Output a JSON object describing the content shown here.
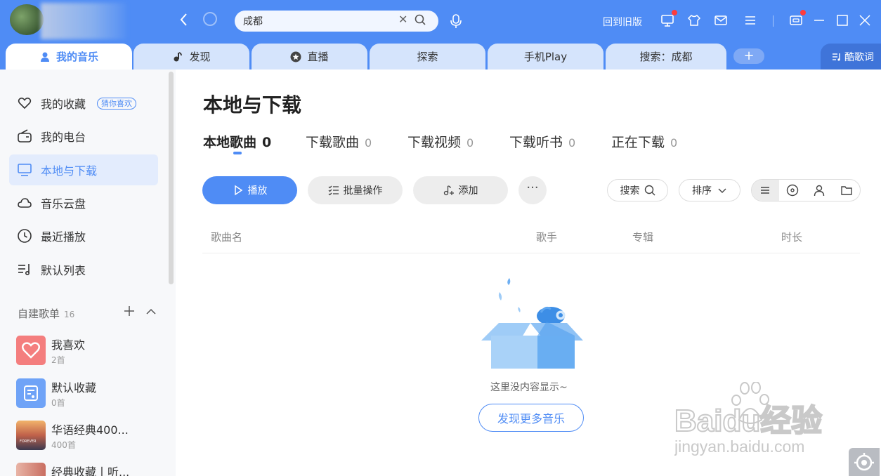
{
  "topbar": {
    "search_value": "成都",
    "old_version_label": "回到旧版",
    "accent_color": "#4f8cf5"
  },
  "tabs": [
    {
      "label": "我的音乐",
      "icon": "user-icon",
      "active": true
    },
    {
      "label": "发现",
      "icon": "music-note-icon"
    },
    {
      "label": "直播",
      "icon": "star-circle-icon"
    },
    {
      "label": "探索"
    },
    {
      "label": "手机Play"
    },
    {
      "label": "搜索：成都"
    }
  ],
  "lyrics_label": "酷歌词",
  "sidebar": {
    "items": [
      {
        "label": "我的收藏",
        "icon": "heart-icon",
        "badge": "猜你喜欢"
      },
      {
        "label": "我的电台",
        "icon": "radio-icon"
      },
      {
        "label": "本地与下载",
        "icon": "monitor-icon",
        "active": true
      },
      {
        "label": "音乐云盘",
        "icon": "cloud-icon"
      },
      {
        "label": "最近播放",
        "icon": "clock-icon"
      },
      {
        "label": "默认列表",
        "icon": "playlist-icon"
      }
    ],
    "playlists_header": "自建歌单",
    "playlists_count": "16",
    "playlists": [
      {
        "name": "我喜欢",
        "sub": "2首"
      },
      {
        "name": "默认收藏",
        "sub": "0首"
      },
      {
        "name": "华语经典400...",
        "sub": "400首",
        "cover_text": "FOREVER"
      },
      {
        "name": "经典收藏丨听..."
      }
    ]
  },
  "main": {
    "title": "本地与下载",
    "subtabs": [
      {
        "label": "本地歌曲",
        "count": "0",
        "active": true
      },
      {
        "label": "下载歌曲",
        "count": "0"
      },
      {
        "label": "下载视频",
        "count": "0"
      },
      {
        "label": "下载听书",
        "count": "0"
      },
      {
        "label": "正在下载",
        "count": "0"
      }
    ],
    "buttons": {
      "play": "播放",
      "batch": "批量操作",
      "add": "添加",
      "more": "···",
      "search": "搜索",
      "sort": "排序"
    },
    "table_headers": [
      "歌曲名",
      "歌手",
      "专辑",
      "时长"
    ],
    "empty_text": "这里没内容显示~",
    "discover_button": "发现更多音乐"
  },
  "watermark": {
    "logo_text": "Baidu经验",
    "url_text": "jingyan.baidu.com"
  }
}
